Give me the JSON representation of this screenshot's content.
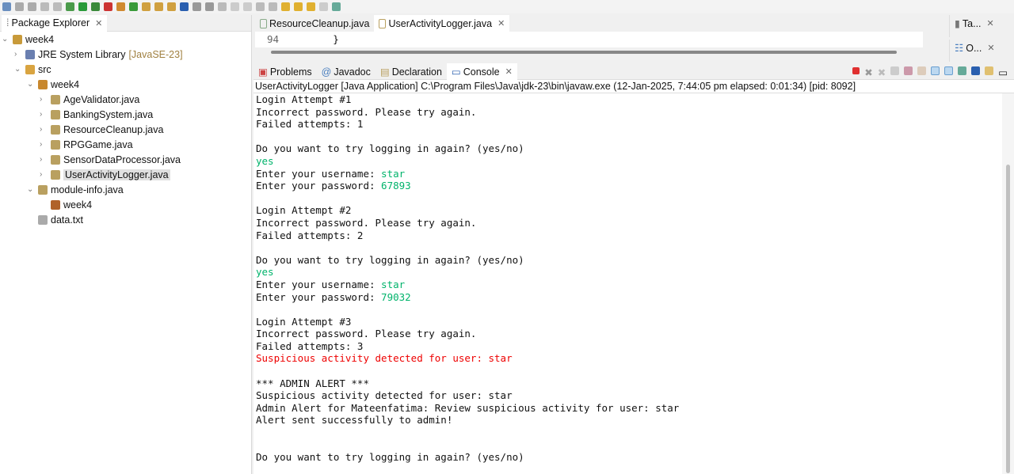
{
  "package_explorer": {
    "title": "Package Explorer",
    "tree": [
      {
        "label": "week4",
        "indent": 0,
        "chev": "⌄",
        "icon": "project-icon",
        "color": "#c89a3a"
      },
      {
        "label": "JRE System Library",
        "suffix": "[JavaSE-23]",
        "indent": 1,
        "chev": "›",
        "icon": "library-icon",
        "color": "#6a7fb0"
      },
      {
        "label": "src",
        "indent": 1,
        "chev": "⌄",
        "icon": "source-folder-icon",
        "color": "#d9a441"
      },
      {
        "label": "week4",
        "indent": 2,
        "chev": "⌄",
        "icon": "package-icon",
        "color": "#c8882e"
      },
      {
        "label": "AgeValidator.java",
        "indent": 3,
        "chev": "›",
        "icon": "java-file-icon",
        "color": "#b9a060"
      },
      {
        "label": "BankingSystem.java",
        "indent": 3,
        "chev": "›",
        "icon": "java-file-icon",
        "color": "#b9a060"
      },
      {
        "label": "ResourceCleanup.java",
        "indent": 3,
        "chev": "›",
        "icon": "java-file-icon",
        "color": "#b9a060"
      },
      {
        "label": "RPGGame.java",
        "indent": 3,
        "chev": "›",
        "icon": "java-file-icon",
        "color": "#b9a060"
      },
      {
        "label": "SensorDataProcessor.java",
        "indent": 3,
        "chev": "›",
        "icon": "java-file-icon",
        "color": "#b9a060"
      },
      {
        "label": "UserActivityLogger.java",
        "indent": 3,
        "chev": "›",
        "icon": "java-file-icon",
        "color": "#b9a060",
        "selected": true
      },
      {
        "label": "module-info.java",
        "indent": 2,
        "chev": "⌄",
        "icon": "java-file-icon",
        "color": "#b9a060"
      },
      {
        "label": "week4",
        "indent": 3,
        "chev": "",
        "icon": "module-icon",
        "color": "#b0622a"
      },
      {
        "label": "data.txt",
        "indent": 2,
        "chev": "",
        "icon": "text-file-icon",
        "color": "#aaaaaa"
      }
    ]
  },
  "editor": {
    "tabs": [
      {
        "label": "ResourceCleanup.java"
      },
      {
        "label": "UserActivityLogger.java",
        "active": true
      }
    ],
    "line_number": "94",
    "line_code": "        }"
  },
  "side_panels": {
    "tasks": "Ta...",
    "outline": "O..."
  },
  "console": {
    "tabs": [
      {
        "label": "Problems"
      },
      {
        "label": "Javadoc"
      },
      {
        "label": "Declaration"
      },
      {
        "label": "Console",
        "active": true
      }
    ],
    "status": "UserActivityLogger [Java Application] C:\\Program Files\\Java\\jdk-23\\bin\\javaw.exe  (12-Jan-2025, 7:44:05 pm elapsed: 0:01:34) [pid: 8092]",
    "lines": [
      {
        "t": "Login Attempt #1"
      },
      {
        "t": "Incorrect password. Please try again."
      },
      {
        "t": "Failed attempts: 1"
      },
      {
        "t": ""
      },
      {
        "t": "Do you want to try logging in again? (yes/no)"
      },
      {
        "t": "",
        "in": "yes"
      },
      {
        "t": "Enter your username: ",
        "in": "star"
      },
      {
        "t": "Enter your password: ",
        "in": "67893"
      },
      {
        "t": ""
      },
      {
        "t": "Login Attempt #2"
      },
      {
        "t": "Incorrect password. Please try again."
      },
      {
        "t": "Failed attempts: 2"
      },
      {
        "t": ""
      },
      {
        "t": "Do you want to try logging in again? (yes/no)"
      },
      {
        "t": "",
        "in": "yes"
      },
      {
        "t": "Enter your username: ",
        "in": "star"
      },
      {
        "t": "Enter your password: ",
        "in": "79032"
      },
      {
        "t": ""
      },
      {
        "t": "Login Attempt #3"
      },
      {
        "t": "Incorrect password. Please try again."
      },
      {
        "t": "Failed attempts: 3"
      },
      {
        "t": "",
        "err": "Suspicious activity detected for user: star"
      },
      {
        "t": ""
      },
      {
        "t": "*** ADMIN ALERT ***"
      },
      {
        "t": "Suspicious activity detected for user: star"
      },
      {
        "t": "Admin Alert for Mateenfatima: Review suspicious activity for user: star"
      },
      {
        "t": "Alert sent successfully to admin!"
      },
      {
        "t": ""
      },
      {
        "t": ""
      },
      {
        "t": "Do you want to try logging in again? (yes/no)"
      }
    ]
  },
  "colors": {
    "input": "#00b36b",
    "error": "#e00000"
  }
}
